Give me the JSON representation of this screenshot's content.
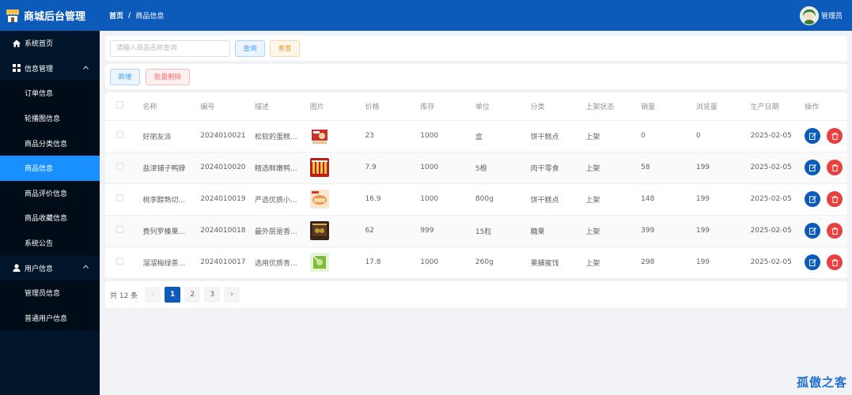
{
  "app": {
    "title": "商城后台管理"
  },
  "breadcrumb": {
    "home": "首页",
    "separator": "/",
    "current": "商品信息"
  },
  "user": {
    "name": "管理员"
  },
  "sidebar": {
    "items": [
      {
        "label": "系统首页",
        "icon": "home-icon"
      },
      {
        "label": "信息管理",
        "icon": "grid-icon"
      },
      {
        "label": "订单信息"
      },
      {
        "label": "轮播图信息"
      },
      {
        "label": "商品分类信息"
      },
      {
        "label": "商品信息"
      },
      {
        "label": "商品评价信息"
      },
      {
        "label": "商品收藏信息"
      },
      {
        "label": "系统公告"
      },
      {
        "label": "用户信息",
        "icon": "user-icon"
      },
      {
        "label": "管理员信息"
      },
      {
        "label": "普通用户信息"
      }
    ]
  },
  "search": {
    "placeholder": "请输入商品名称查询",
    "value": "",
    "query_label": "查询",
    "reset_label": "重置"
  },
  "toolbar": {
    "add_label": "新增",
    "batch_delete_label": "批量删除"
  },
  "table": {
    "headers": [
      "名称",
      "编号",
      "描述",
      "图片",
      "价格",
      "库存",
      "单位",
      "分类",
      "上架状态",
      "销量",
      "浏览量",
      "生产日期",
      "操作"
    ],
    "rows": [
      {
        "name": "好丽友派",
        "code": "2024010021",
        "desc": "松软的蛋糕...",
        "price": "23",
        "stock": "1000",
        "unit": "盒",
        "category": "饼干糕点",
        "status": "上架",
        "sales": "0",
        "views": "0",
        "date": "2025-02-05"
      },
      {
        "name": "盐津铺子鸭脖",
        "code": "2024010020",
        "desc": "精选鲜嫩鸭...",
        "price": "7.9",
        "stock": "1000",
        "unit": "5根",
        "category": "肉干零食",
        "status": "上架",
        "sales": "58",
        "views": "199",
        "date": "2025-02-05"
      },
      {
        "name": "桃李醇熟切...",
        "code": "2024010019",
        "desc": "严选优质小...",
        "price": "16.9",
        "stock": "1000",
        "unit": "800g",
        "category": "饼干糕点",
        "status": "上架",
        "sales": "148",
        "views": "199",
        "date": "2025-02-05"
      },
      {
        "name": "费列罗榛果...",
        "code": "2024010018",
        "desc": "最外层是香...",
        "price": "62",
        "stock": "999",
        "unit": "15粒",
        "category": "糖果",
        "status": "上架",
        "sales": "399",
        "views": "199",
        "date": "2025-02-05"
      },
      {
        "name": "溜溜梅绿茶...",
        "code": "2024010017",
        "desc": "选用优质青...",
        "price": "17.8",
        "stock": "1000",
        "unit": "260g",
        "category": "果脯蜜饯",
        "status": "上架",
        "sales": "298",
        "views": "199",
        "date": "2025-02-05"
      }
    ]
  },
  "pagination": {
    "total_label": "共 12 条",
    "pages": [
      "1",
      "2",
      "3"
    ],
    "current": "1",
    "prev": "‹",
    "next": "›"
  },
  "watermark": "孤傲之客",
  "colors": {
    "header": "#0c5ab9",
    "sidebar": "#001529",
    "active": "#1890ff",
    "danger": "#e8413f"
  }
}
